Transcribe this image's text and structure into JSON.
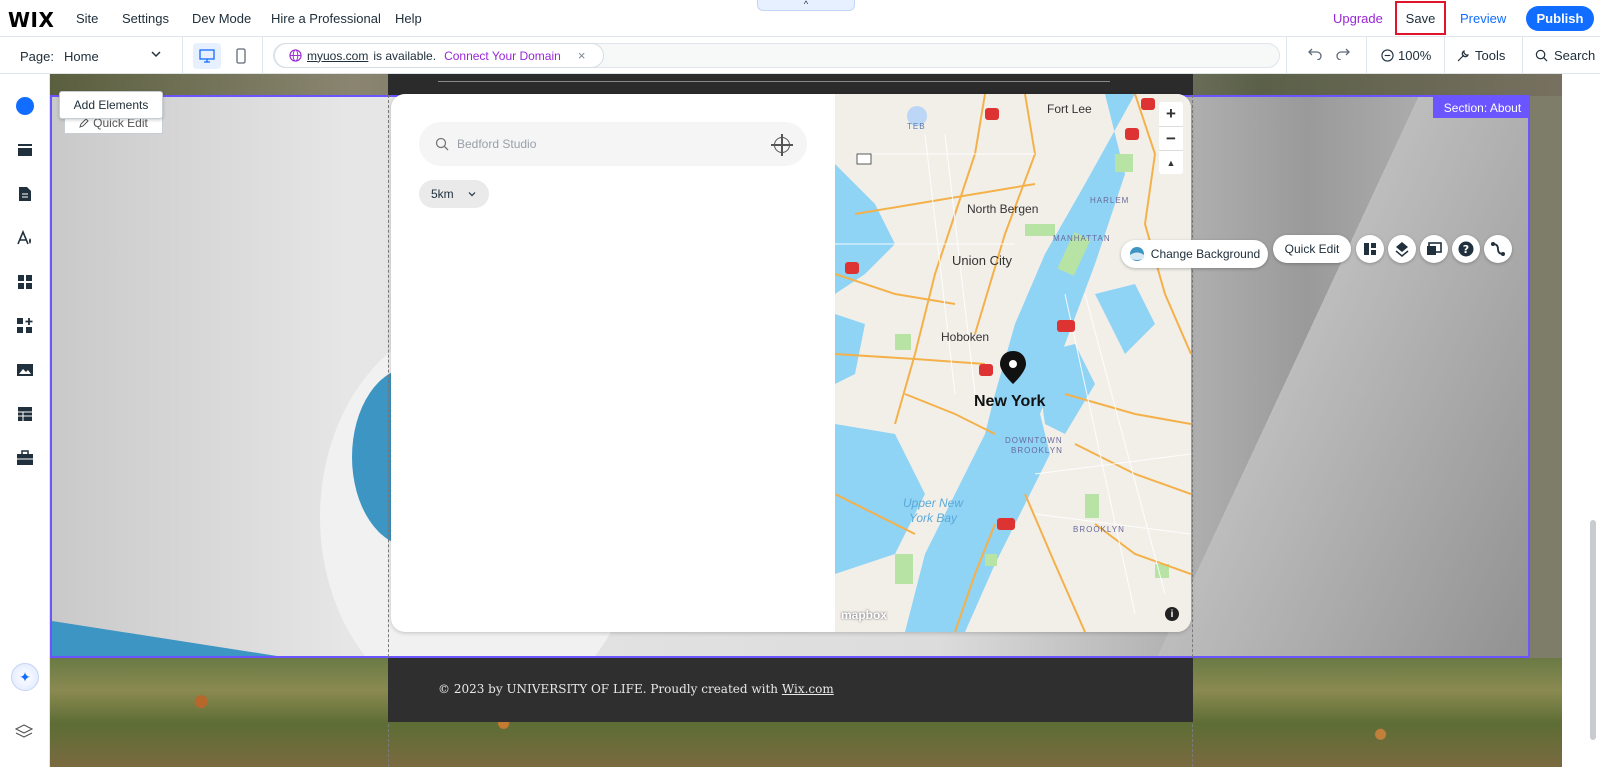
{
  "topbar": {
    "logo": "WIX",
    "menu": [
      "Site",
      "Settings",
      "Dev Mode",
      "Hire a Professional",
      "Help"
    ],
    "collapse": "^",
    "upgrade": "Upgrade",
    "save": "Save",
    "preview": "Preview",
    "publish": "Publish"
  },
  "secondbar": {
    "page_label": "Page:",
    "page_value": "Home",
    "domain_link": "myuos.com",
    "domain_available": "is available.",
    "connect_domain": "Connect Your Domain",
    "domain_close": "×",
    "zoom": "100%",
    "tools": "Tools",
    "search": "Search"
  },
  "canvas": {
    "section_tag": "Section: About",
    "add_elements": "Add Elements",
    "quick_edit_top": "Quick Edit",
    "change_background": "Change Background",
    "quick_edit": "Quick Edit",
    "footer_text": "© 2023 by UNIVERSITY OF LIFE. Proudly created with ",
    "footer_link": "Wix.com"
  },
  "widget": {
    "search_placeholder": "Bedford Studio",
    "radius": "5km",
    "map": {
      "labels": [
        "Fort Lee",
        "TEB",
        "North Bergen",
        "HARLEM",
        "MANHATTAN",
        "Union City",
        "Hoboken",
        "New York",
        "DOWNTOWN",
        "BROOKLYN",
        "BROOKLYN"
      ],
      "water_label_1": "Upper New",
      "water_label_2": "York Bay",
      "attribution": "mapbox",
      "zoom_in": "+",
      "zoom_out": "−",
      "compass": "▲",
      "info": "i"
    }
  },
  "colors": {
    "accent": "#116dff",
    "upgrade": "#9a27d5",
    "section_outline": "#6b55ff",
    "save_highlight": "#e0142a"
  }
}
